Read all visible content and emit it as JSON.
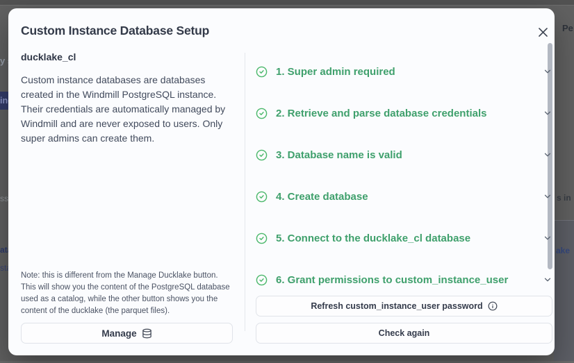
{
  "modal": {
    "title": "Custom Instance Database Setup",
    "left": {
      "heading": "ducklake_cl",
      "description": "Custom instance databases are databases created in the Windmill PostgreSQL instance. Their credentials are automatically managed by Windmill and are never exposed to users. Only super admins can create them.",
      "note": "Note: this is different from the Manage Ducklake button. This will show you the content of the PostgreSQL database used as a catalog, while the other button shows you the content of the ducklake (the parquet files).",
      "manage_label": "Manage"
    },
    "steps": [
      {
        "label": "1. Super admin required",
        "status": "passed"
      },
      {
        "label": "2. Retrieve and parse database credentials",
        "status": "passed"
      },
      {
        "label": "3. Database name is valid",
        "status": "passed"
      },
      {
        "label": "4. Create database",
        "status": "passed"
      },
      {
        "label": "5. Connect to the ducklake_cl database",
        "status": "passed"
      },
      {
        "label": "6. Grant permissions to custom_instance_user",
        "status": "passed"
      }
    ],
    "footer": {
      "refresh_label": "Refresh custom_instance_user password",
      "check_label": "Check again"
    }
  },
  "background": {
    "left_frag_1": "y s",
    "left_frag_selected": "ing",
    "left_frag_2": "ss",
    "left_frag_3": "ata",
    "left_frag_4": "sta",
    "right_frag_1": "Pe",
    "right_frag_2": "s in",
    "right_frag_3": "ake"
  },
  "colors": {
    "step_green_text": "#3fa06c",
    "step_green_icon": "#4bb86b",
    "modal_bg": "#fbfcfe",
    "overlay_gray": "#616161",
    "divider": "#e4e7ec",
    "button_border": "#e0e3e9",
    "title_text": "#333a49"
  }
}
